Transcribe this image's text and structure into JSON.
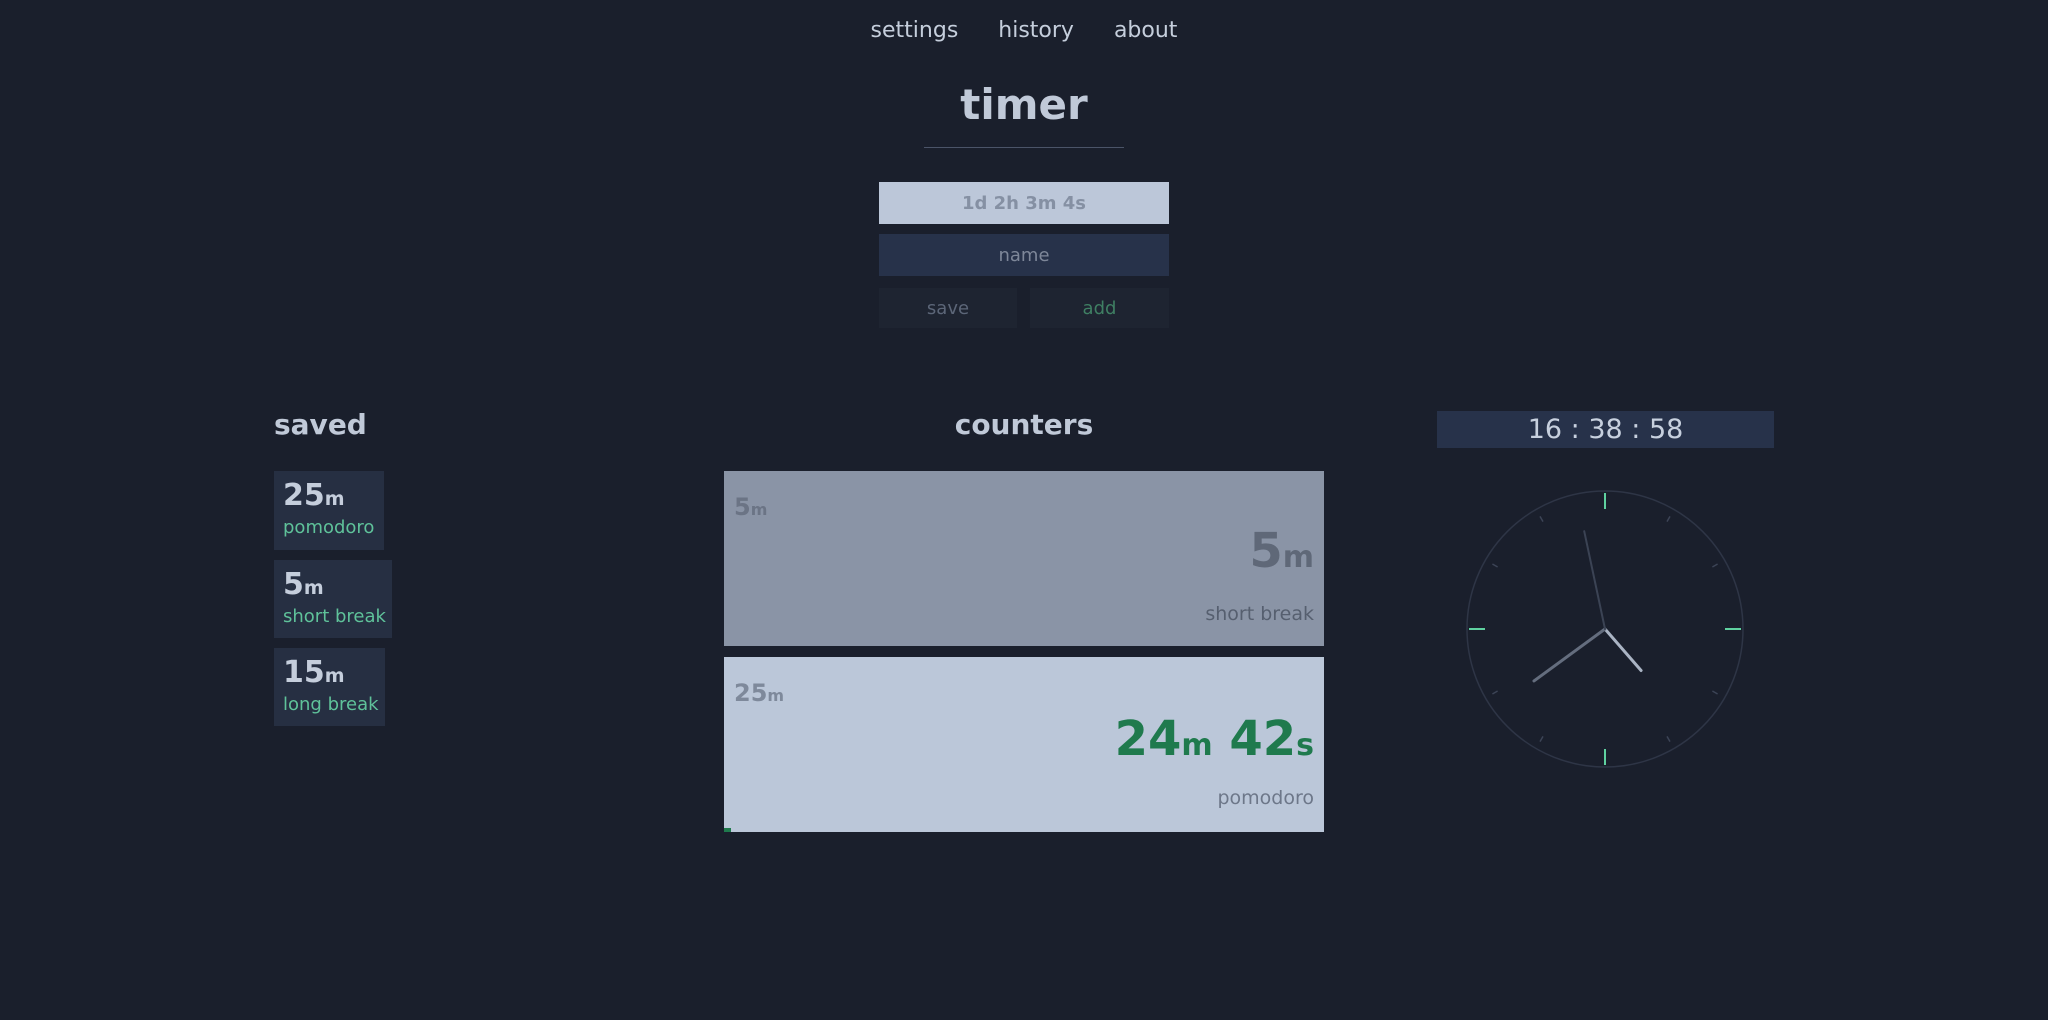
{
  "nav": {
    "settings": "settings",
    "history": "history",
    "about": "about"
  },
  "title": "timer",
  "form": {
    "time_placeholder": "1d 2h 3m 4s",
    "name_placeholder": "name",
    "save_label": "save",
    "add_label": "add"
  },
  "saved": {
    "heading": "saved",
    "items": [
      {
        "value": "25",
        "unit": "m",
        "name": "pomodoro"
      },
      {
        "value": "5",
        "unit": "m",
        "name": "short break"
      },
      {
        "value": "15",
        "unit": "m",
        "name": "long break"
      }
    ]
  },
  "counters": {
    "heading": "counters",
    "items": [
      {
        "original_value": "5",
        "original_unit": "m",
        "remaining": [
          {
            "value": "5",
            "unit": "m"
          }
        ],
        "name": "short break"
      },
      {
        "original_value": "25",
        "original_unit": "m",
        "remaining": [
          {
            "value": "24",
            "unit": "m"
          },
          {
            "value": "42",
            "unit": "s"
          }
        ],
        "name": "pomodoro",
        "progress": 0.012
      }
    ]
  },
  "clock": {
    "digital": "16 : 38 : 58",
    "hours": 16,
    "minutes": 38,
    "seconds": 58,
    "colors": {
      "face_stroke": "#2e3546",
      "tick_major": "#5fd1a0",
      "tick_minor": "#3c4456",
      "hour_hand": "#aab4c4",
      "minute_hand": "#646d7e",
      "second_hand": "#3b4354"
    }
  },
  "colors": {
    "background": "#1a1f2c",
    "accent_green": "#5fc29a",
    "counter_green": "#1f7a4d"
  }
}
